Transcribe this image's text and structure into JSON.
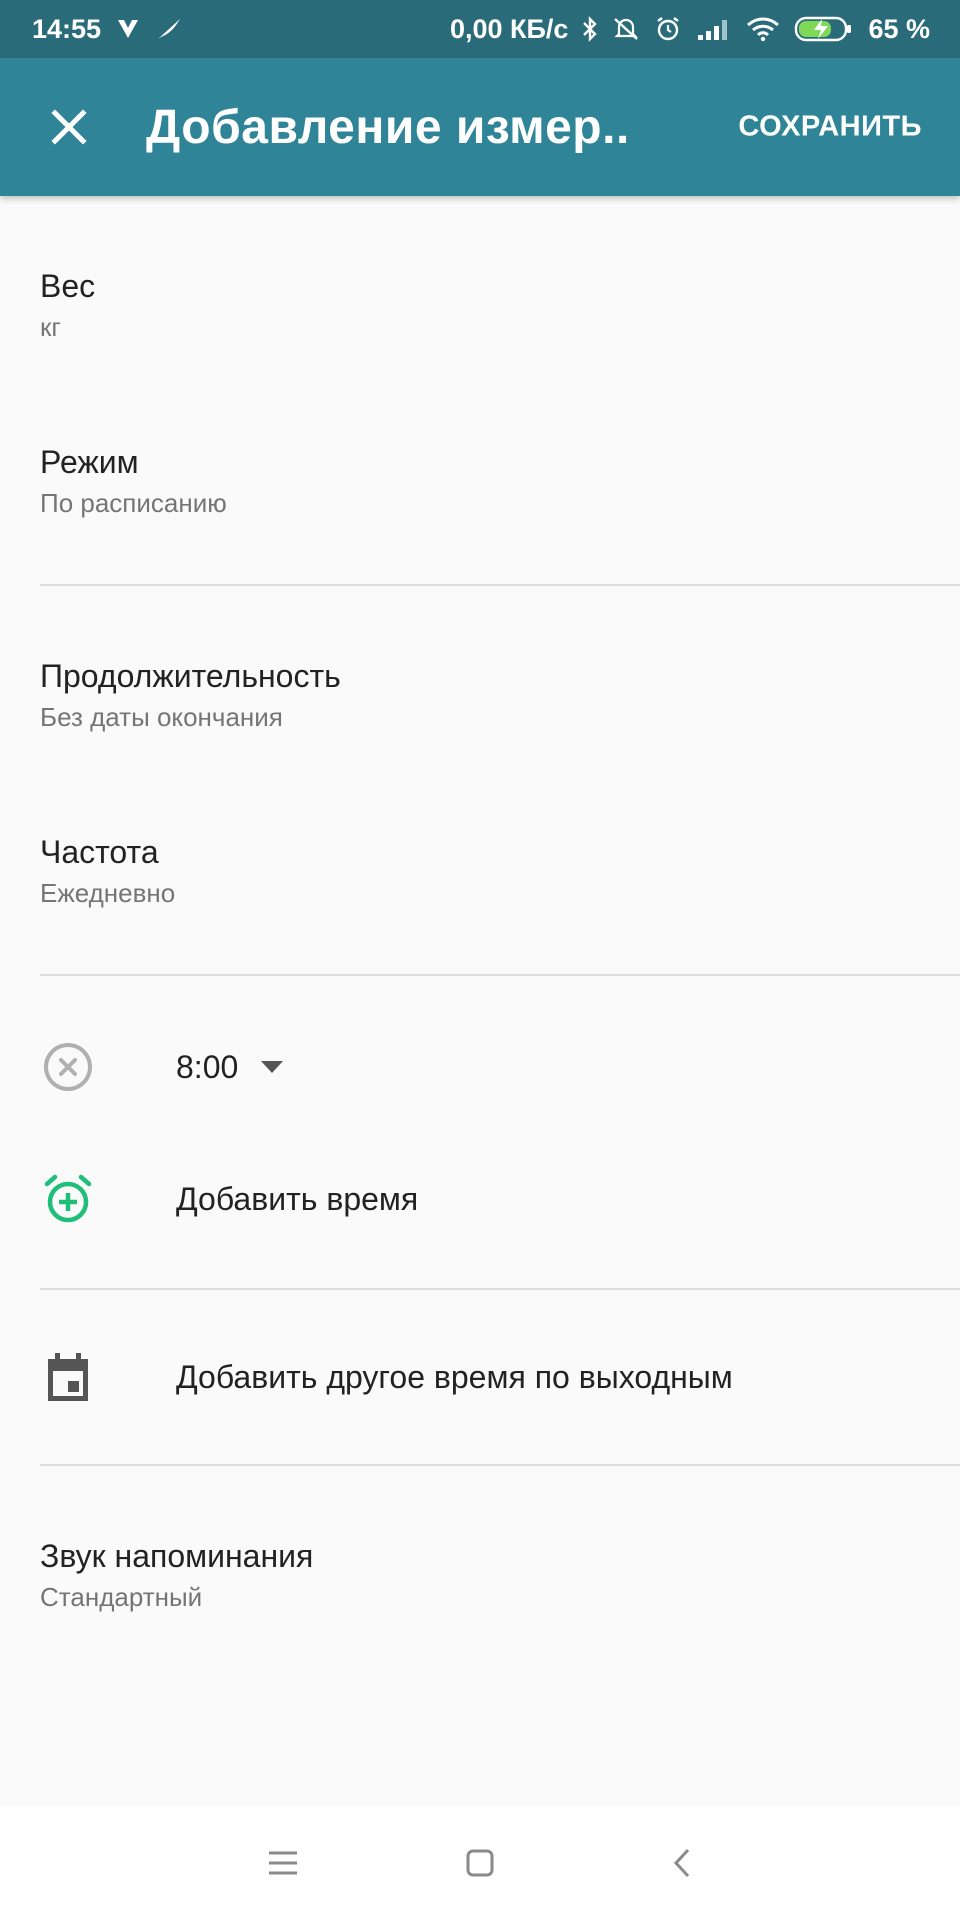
{
  "status_bar": {
    "time": "14:55",
    "network_speed": "0,00 КБ/с",
    "battery_percent": "65 %"
  },
  "app_bar": {
    "title": "Добавление измер...",
    "save_label": "СОХРАНИТЬ"
  },
  "settings": {
    "weight": {
      "label": "Вес",
      "unit": "кг"
    },
    "mode": {
      "label": "Режим",
      "value": "По расписанию"
    },
    "duration": {
      "label": "Продолжительность",
      "value": "Без даты окончания"
    },
    "frequency": {
      "label": "Частота",
      "value": "Ежедневно"
    },
    "time_entry": {
      "value": "8:00"
    },
    "add_time": {
      "label": "Добавить время"
    },
    "weekend_time": {
      "label": "Добавить другое время по выходным"
    },
    "reminder_sound": {
      "label": "Звук напоминания",
      "value": "Стандартный"
    }
  },
  "colors": {
    "status_bar": "#2a6b7a",
    "app_bar": "#2f8597",
    "accent_green": "#1fbf7a",
    "icon_gray": "#9e9e9e",
    "background": "#fafafa"
  },
  "icons": {
    "close": "close-icon",
    "remove_time": "remove-circle-icon",
    "dropdown": "dropdown-arrow-icon",
    "add_alarm": "add-alarm-icon",
    "calendar": "calendar-icon",
    "nav_menu": "menu-icon",
    "nav_home": "home-square-icon",
    "nav_back": "back-chevron-icon"
  }
}
